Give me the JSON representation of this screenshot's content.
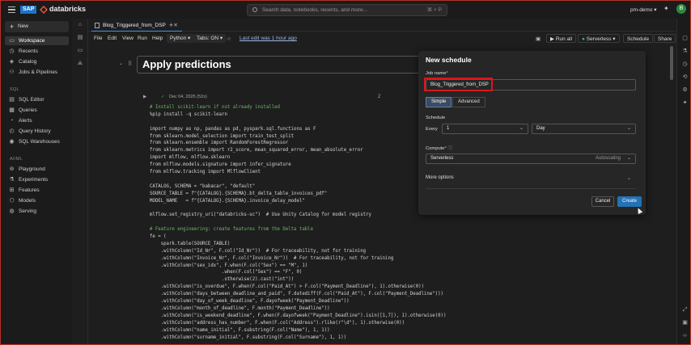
{
  "topbar": {
    "brand_sap": "SAP",
    "brand_name": "databricks",
    "search_placeholder": "Search data, notebooks, recents, and more...",
    "search_shortcut": "⌘ + P",
    "workspace": "pm-demo ▾",
    "avatar_initial": "B"
  },
  "sidebar": {
    "new_label": "New",
    "items": [
      {
        "label": "Workspace",
        "icon": "folder-icon"
      },
      {
        "label": "Recents",
        "icon": "clock-icon"
      },
      {
        "label": "Catalog",
        "icon": "catalog-icon"
      },
      {
        "label": "Jobs & Pipelines",
        "icon": "workflow-icon"
      }
    ],
    "sql_section": "SQL",
    "sql_items": [
      {
        "label": "SQL Editor"
      },
      {
        "label": "Queries"
      },
      {
        "label": "Alerts"
      },
      {
        "label": "Query History"
      },
      {
        "label": "SQL Warehouses"
      }
    ],
    "ml_section": "AI/ML",
    "ml_items": [
      {
        "label": "Playground"
      },
      {
        "label": "Experiments"
      },
      {
        "label": "Features"
      },
      {
        "label": "Models"
      },
      {
        "label": "Serving"
      }
    ]
  },
  "tabs": {
    "active_tab": "Blog_Triggered_from_DSP"
  },
  "menubar": {
    "file": "File",
    "edit": "Edit",
    "view": "View",
    "run": "Run",
    "help": "Help",
    "language": "Python ▾",
    "tabs_setting": "Tabs: ON ▾",
    "last_edit": "Last edit was 1 hour ago",
    "run_all": "Run all",
    "compute": "Serverless ▾",
    "schedule": "Schedule",
    "share": "Share"
  },
  "notebook": {
    "title": "Apply predictions",
    "cell_status": "Dec 04, 2025 (52s)",
    "cell_number": "2",
    "code_lines": [
      "# Install scikit-learn if not already installed",
      "%pip install -q scikit-learn",
      "",
      "import numpy as np, pandas as pd, pyspark.sql.functions as F",
      "from sklearn.model_selection import train_test_split",
      "from sklearn.ensemble import RandomForestRegressor",
      "from sklearn.metrics import r2_score, mean_squared_error, mean_absolute_error",
      "import mlflow, mlflow.sklearn",
      "from mlflow.models.signature import infer_signature",
      "from mlflow.tracking import MlflowClient",
      "",
      "CATALOG, SCHEMA = \"babacar\", \"default\"",
      "SOURCE_TABLE = f\"{CATALOG}.{SCHEMA}.bt_delta_table_invoices_pdf\"",
      "MODEL_NAME   = f\"{CATALOG}.{SCHEMA}.invoice_delay_model\"",
      "",
      "mlflow.set_registry_uri(\"databricks-uc\")  # Use Unity Catalog for model registry",
      "",
      "# Feature engineering: create features from the Delta table",
      "fe = (",
      "    spark.table(SOURCE_TABLE)",
      "    .withColumn(\"Id_Nr\", F.col(\"Id_Nr\"))  # For traceability, not for training",
      "    .withColumn(\"Invoice_Nr\", F.col(\"Invoice_Nr\"))  # For traceability, not for training",
      "    .withColumn(\"sex_idx\", F.when(F.col(\"Sex\") == \"M\", 1)",
      "                          .when(F.col(\"Sex\") == \"F\", 0)",
      "                          .otherwise(2).cast(\"int\"))",
      "    .withColumn(\"is_overdue\", F.when(F.col(\"Paid_At\") > F.col(\"Payment_Deadline\"), 1).otherwise(0))",
      "    .withColumn(\"days_between_deadline_and_paid\", F.datediff(F.col(\"Paid_At\"), F.col(\"Payment_Deadline\")))",
      "    .withColumn(\"day_of_week_deadline\", F.dayofweek(\"Payment_Deadline\"))",
      "    .withColumn(\"month_of_deadline\", F.month(\"Payment_Deadline\"))",
      "    .withColumn(\"is_weekend_deadline\", F.when(F.dayofweek(\"Payment_Deadline\").isin([1,7]), 1).otherwise(0))",
      "    .withColumn(\"address_has_number\", F.when(F.col(\"Address\").rlike(r\"\\d\"), 1).otherwise(0))",
      "    .withColumn(\"name_initial\", F.substring(F.col(\"Name\"), 1, 1))",
      "    .withColumn(\"surname_initial\", F.substring(F.col(\"Surname\"), 1, 1))"
    ]
  },
  "modal": {
    "title": "New schedule",
    "job_name_label": "Job name",
    "job_name_value": "Blog_Triggered_from_DSP",
    "mode_simple": "Simple",
    "mode_advanced": "Advanced",
    "schedule_label": "Schedule",
    "every_label": "Every",
    "every_value": "1",
    "unit_value": "Day",
    "compute_label": "Compute",
    "compute_value": "Serverless",
    "compute_aux": "Autoscaling",
    "more_options": "More options",
    "cancel": "Cancel",
    "create": "Create"
  },
  "colors": {
    "accent": "#2272b4",
    "highlight": "#d9161c",
    "frame": "#b5322a"
  }
}
